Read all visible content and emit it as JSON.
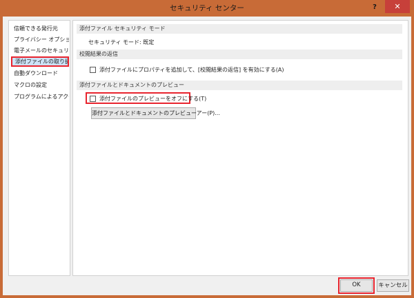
{
  "window": {
    "title": "セキュリティ センター",
    "help_label": "?",
    "close_label": "✕"
  },
  "sidebar": {
    "items": [
      {
        "label": "信頼できる発行元",
        "selected": false
      },
      {
        "label": "プライバシー オプション",
        "selected": false
      },
      {
        "label": "電子メールのセキュリティ",
        "selected": false
      },
      {
        "label": "添付ファイルの取り扱い",
        "selected": true
      },
      {
        "label": "自動ダウンロード",
        "selected": false
      },
      {
        "label": "マクロの設定",
        "selected": false
      },
      {
        "label": "プログラムによるアクセス",
        "selected": false
      }
    ]
  },
  "main": {
    "security_section": {
      "header": "添付ファイル セキュリティ モード",
      "mode_text": "セキュリティ モード: 既定"
    },
    "review_section": {
      "header": "校閲結果の返信",
      "checkbox_label": "添付ファイルにプロパティを追加して、[校閲結果の返信] を有効にする(A)",
      "checked": false
    },
    "preview_section": {
      "header": "添付ファイルとドキュメントのプレビュー",
      "checkbox_label": "添付ファイルのプレビューをオフにする(T)",
      "checked": false,
      "button_label": "添付ファイルとドキュメントのプレビューアー(P)..."
    }
  },
  "footer": {
    "ok_label": "OK",
    "cancel_label": "キャンセル"
  },
  "colors": {
    "title_bar": "#c86b37",
    "close_button": "#c7403a",
    "highlight": "#e8232d",
    "selection": "#cde3f7"
  }
}
